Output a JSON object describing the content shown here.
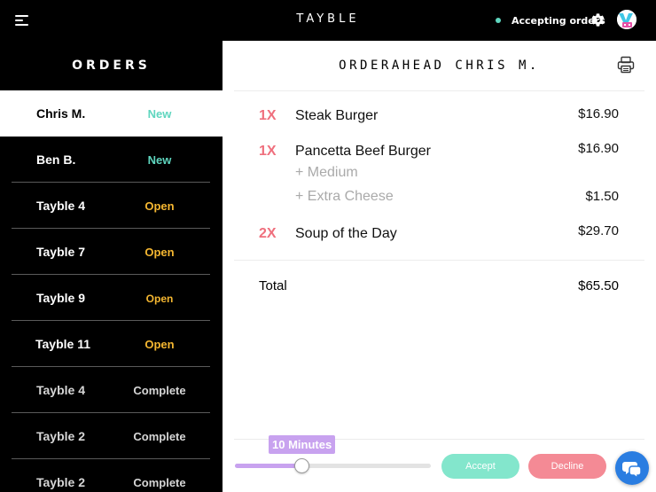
{
  "colors": {
    "accent_purple": "#c8a2ef",
    "new_status": "#5fd6bf",
    "open_status": "#f5b731",
    "complete_status": "#d6d6d6",
    "qty": "#ef6f7d",
    "accept": "#83e6cc",
    "decline": "#f48a95",
    "chat": "#2a7de1"
  },
  "header": {
    "brand": "TAYBLE",
    "status_text": "Accepting orders",
    "icons": [
      "menu-icon",
      "gear-icon",
      "avatar"
    ]
  },
  "sidebar": {
    "title": "ORDERS",
    "orders": [
      {
        "name": "Chris M.",
        "status": "New"
      },
      {
        "name": "Ben B.",
        "status": "New"
      },
      {
        "name": "Tayble 4",
        "status": "Open"
      },
      {
        "name": "Tayble 7",
        "status": "Open"
      },
      {
        "name": "Tayble 9",
        "status": "Open"
      },
      {
        "name": "Tayble 11",
        "status": "Open"
      },
      {
        "name": "Tayble 4",
        "status": "Complete"
      },
      {
        "name": "Tayble 2",
        "status": "Complete"
      },
      {
        "name": "Tayble 2",
        "status": "Complete"
      }
    ]
  },
  "order_detail": {
    "title": "ORDERAHEAD CHRIS M.",
    "items": [
      {
        "qty": "1X",
        "name": "Steak Burger",
        "price": "$16.90",
        "modifiers": []
      },
      {
        "qty": "1X",
        "name": "Pancetta Beef Burger",
        "price": "$16.90",
        "modifiers": [
          {
            "label": "+ Medium",
            "price": ""
          },
          {
            "label": "+ Extra Cheese",
            "price": "$1.50"
          }
        ]
      },
      {
        "qty": "2X",
        "name": "Soup of the Day",
        "price": "$29.70",
        "modifiers": []
      }
    ],
    "total_label": "Total",
    "total_value": "$65.50"
  },
  "controls": {
    "prep_time_label": "10 Minutes",
    "prep_time_level_fraction": 0.34,
    "accept_label": "Accept",
    "decline_label": "Decline"
  }
}
